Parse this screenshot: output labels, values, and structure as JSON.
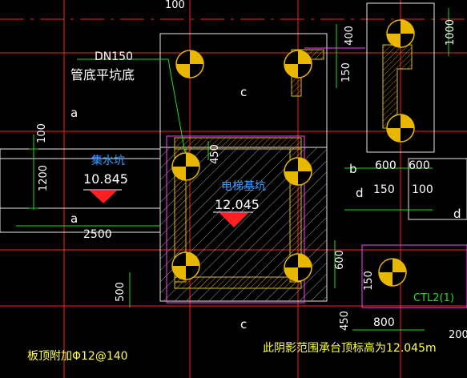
{
  "drawing": {
    "pipe": {
      "size": "DN150",
      "note": "管底平坑底"
    },
    "pit_label": "集水坑",
    "pit_elev": "10.845",
    "elev_pit_label": "电梯基坑",
    "elev_pit_elev": "12.045",
    "c_mark": "c",
    "a_mark": "a",
    "b_mark": "b",
    "d_mark": "d",
    "dims": {
      "d100_top": "100",
      "d400": "400",
      "d1000": "1000",
      "d150_a": "150",
      "d450_a": "450",
      "d100_left": "100",
      "d1200": "1200",
      "d2500": "2500",
      "d600_a": "600",
      "d600_b": "600",
      "d150_b": "150",
      "d100_b": "100",
      "d600_c": "600",
      "d150_c": "150",
      "d500": "500",
      "d450_b": "450",
      "d800": "800",
      "d200": "200"
    },
    "tag_ctl": "CTL2(1)",
    "note_bottom": "此阴影范围承台顶标高为12.045m",
    "note_rebar": "板顶附加Φ12@140"
  },
  "colors": {
    "bg": "#000000",
    "grid_red": "#ff2020",
    "wall_white": "#e8e8e8",
    "dim_green": "#22dd22",
    "hatch_gray": "#9a9a9a",
    "fill_yellow": "#e8b800",
    "text_blue": "#3aa0ff",
    "text_white": "#ffffff",
    "magenta": "#ff40ff",
    "dashed_yellow": "#e0c000"
  }
}
